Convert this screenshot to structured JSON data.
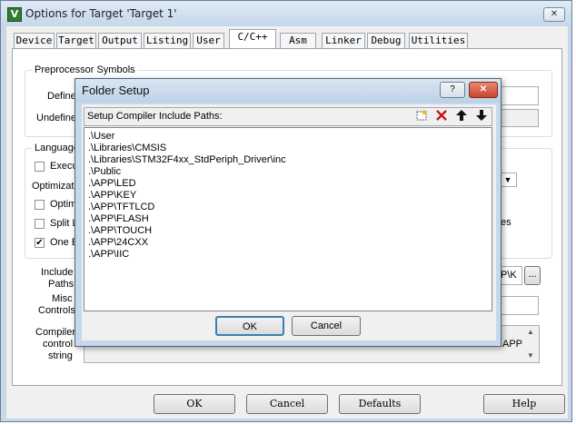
{
  "window": {
    "title": "Options for Target 'Target 1'",
    "app_icon_glyph": "V",
    "close_glyph": "✕"
  },
  "tabs": [
    {
      "label": "Device"
    },
    {
      "label": "Target"
    },
    {
      "label": "Output"
    },
    {
      "label": "Listing"
    },
    {
      "label": "User"
    },
    {
      "label": "C/C++"
    },
    {
      "label": "Asm"
    },
    {
      "label": "Linker"
    },
    {
      "label": "Debug"
    },
    {
      "label": "Utilities"
    }
  ],
  "active_tab": "C/C++",
  "cc_panel": {
    "preprocessor_group": "Preprocessor Symbols",
    "define_label": "Define",
    "undefine_label": "Undefine",
    "language_group": "Language",
    "execute_only_label": "Execu",
    "optimization_label": "Optimization",
    "optimize_time_label": "Optim",
    "split_load_label": "Split L",
    "one_elf_label": "One E",
    "one_elf_checked": "✔",
    "right_text_es": "es",
    "include_paths_label_1": "Include",
    "include_paths_label_2": "Paths",
    "include_paths_value": "P\\K",
    "browse_label": "...",
    "misc_controls_label_1": "Misc",
    "misc_controls_label_2": "Controls",
    "compiler_control_label_1": "Compiler",
    "compiler_control_label_2": "control",
    "compiler_control_label_3": "string",
    "compiler_control_tail": "APP",
    "dropdown_arrow": "▼",
    "scroll_up": "▲",
    "scroll_down": "▼"
  },
  "bottom_buttons": {
    "ok": "OK",
    "cancel": "Cancel",
    "defaults": "Defaults",
    "help": "Help"
  },
  "folder_dialog": {
    "title": "Folder Setup",
    "help_glyph": "?",
    "close_glyph": "✕",
    "header_label": "Setup Compiler Include Paths:",
    "toolbar": {
      "new_icon": "new-folder-icon",
      "delete_icon": "delete-icon",
      "up_icon": "move-up-icon",
      "down_icon": "move-down-icon",
      "delete_color": "#cc1111"
    },
    "paths": [
      ".\\User",
      ".\\Libraries\\CMSIS",
      ".\\Libraries\\STM32F4xx_StdPeriph_Driver\\inc",
      ".\\Public",
      ".\\APP\\LED",
      ".\\APP\\KEY",
      ".\\APP\\TFTLCD",
      ".\\APP\\FLASH",
      ".\\APP\\TOUCH",
      ".\\APP\\24CXX",
      ".\\APP\\IIC"
    ],
    "ok": "OK",
    "cancel": "Cancel"
  }
}
